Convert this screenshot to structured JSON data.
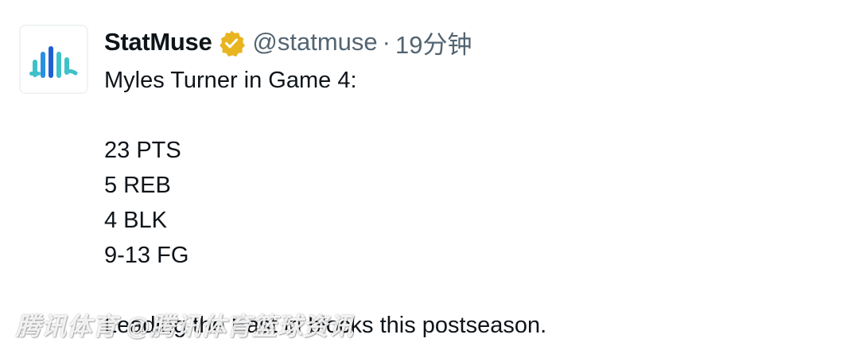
{
  "tweet": {
    "author": {
      "display_name": "StatMuse",
      "handle": "@statmuse",
      "avatar_icon": "statmuse-logo-icon",
      "verified_icon": "gold-verified-badge-icon",
      "verified_color": "#e8b420"
    },
    "separator": "·",
    "timestamp": "19分钟",
    "body_lines": [
      "Myles Turner in Game 4:",
      "",
      "23 PTS",
      "5 REB",
      "4 BLK",
      "9-13 FG",
      "",
      "Leading the East in blocks this postseason."
    ]
  },
  "watermark": {
    "text": "腾讯体育 @腾讯体育篮球资讯"
  },
  "colors": {
    "text_primary": "#0f1419",
    "text_secondary": "#536471",
    "logo_teal": "#3fc1c9",
    "logo_blue": "#1f5fd1"
  }
}
